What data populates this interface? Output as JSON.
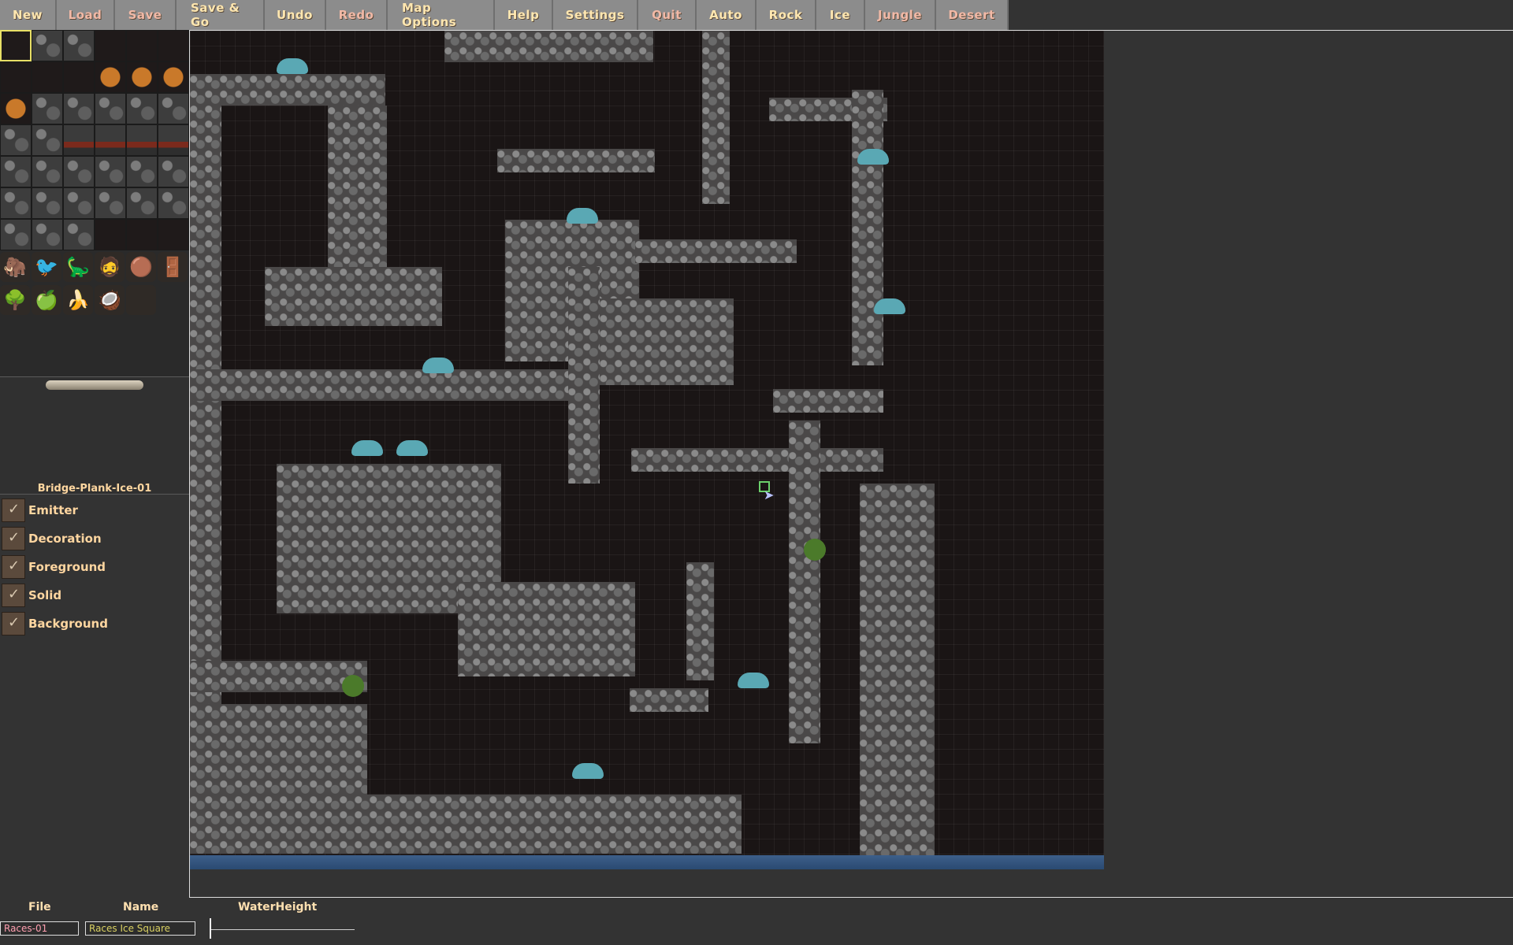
{
  "toolbar": {
    "buttons": [
      {
        "label": "New"
      },
      {
        "label": "Load"
      },
      {
        "label": "Save"
      },
      {
        "label": "Save & Go"
      },
      {
        "label": "Undo"
      },
      {
        "label": "Redo"
      },
      {
        "label": "Map Options"
      },
      {
        "label": "Help"
      },
      {
        "label": "Settings"
      },
      {
        "label": "Quit"
      },
      {
        "label": "Auto"
      },
      {
        "label": "Rock"
      },
      {
        "label": "Ice"
      },
      {
        "label": "Jungle"
      },
      {
        "label": "Desert"
      }
    ]
  },
  "palette": {
    "selected_tile_name": "Bridge-Plank-Ice-01"
  },
  "layers": [
    {
      "label": "Emitter"
    },
    {
      "label": "Decoration"
    },
    {
      "label": "Foreground"
    },
    {
      "label": "Solid"
    },
    {
      "label": "Background"
    }
  ],
  "bottom": {
    "file_label": "File",
    "name_label": "Name",
    "waterheight_label": "WaterHeight",
    "file_value": "Races-01",
    "name_value": "Races Ice Square"
  },
  "colors": {
    "toolbar_bg": "#8c8c8c",
    "panel_bg": "#2a2a2a",
    "map_bg": "#1a1515",
    "water": "#2a4a72",
    "label_text": "#ffd6a0"
  }
}
